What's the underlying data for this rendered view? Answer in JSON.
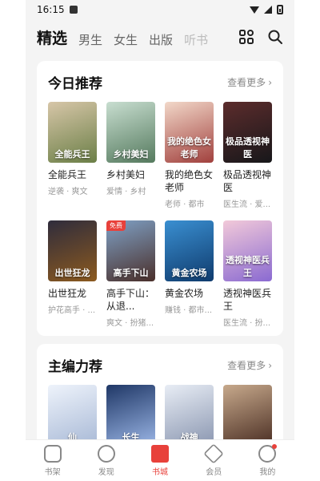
{
  "status": {
    "time": "16:15"
  },
  "topnav": {
    "tabs": [
      "精选",
      "男生",
      "女生",
      "出版",
      "听书"
    ],
    "active_index": 0
  },
  "colors": {
    "accent": "#e8413b",
    "background": "#f4f4f4"
  },
  "today": {
    "title": "今日推荐",
    "more_label": "查看更多",
    "books": [
      {
        "title": "全能兵王",
        "meta": "逆袭 · 爽文",
        "cover_text": "全能兵王",
        "cover_colors": [
          "#d7c6a8",
          "#6b7f47"
        ],
        "free": false
      },
      {
        "title": "乡村美妇",
        "meta": "爱情 · 乡村",
        "cover_text": "乡村美妇",
        "cover_colors": [
          "#c8ded0",
          "#557a5e"
        ],
        "free": false
      },
      {
        "title": "我的绝色女老师",
        "meta": "老师 · 都市",
        "cover_text": "我的绝色女老师",
        "cover_colors": [
          "#f2d8c9",
          "#a1403d"
        ],
        "free": false
      },
      {
        "title": "极品透视神医",
        "meta": "医生流 · 爱...",
        "cover_text": "极品透视神医",
        "cover_colors": [
          "#5c2c2c",
          "#17171a"
        ],
        "free": false
      },
      {
        "title": "出世狂龙",
        "meta": "护花高手 · ...",
        "cover_text": "出世狂龙",
        "cover_colors": [
          "#2f2c3c",
          "#8c5a1f"
        ],
        "free": false
      },
      {
        "title": "高手下山：从退...",
        "meta": "爽文 · 扮猪...",
        "cover_text": "高手下山",
        "cover_colors": [
          "#7fa1c6",
          "#4a2f2a"
        ],
        "free": true,
        "free_label": "免费"
      },
      {
        "title": "黄金农场",
        "meta": "赚钱 · 都市...",
        "cover_text": "黄金农场",
        "cover_colors": [
          "#3a8fd1",
          "#0f3b6d"
        ],
        "free": false
      },
      {
        "title": "透视神医兵王",
        "meta": "医生流 · 扮...",
        "cover_text": "透视神医兵王",
        "cover_colors": [
          "#f2c9d9",
          "#8a6ad1"
        ],
        "free": false
      }
    ]
  },
  "editor": {
    "title": "主编力荐",
    "more_label": "查看更多",
    "covers": [
      {
        "cover_colors": [
          "#eef3fb",
          "#a8b9d6"
        ],
        "cover_text": "仙"
      },
      {
        "cover_colors": [
          "#1f3766",
          "#9bb6e6"
        ],
        "cover_text": "长生"
      },
      {
        "cover_colors": [
          "#e8edf5",
          "#8a96b0"
        ],
        "cover_text": "战神"
      },
      {
        "cover_colors": [
          "#c7a98c",
          "#4a2e23"
        ],
        "cover_text": ""
      }
    ]
  },
  "bottomnav": {
    "items": [
      {
        "label": "书架",
        "icon": "bookshelf-icon"
      },
      {
        "label": "发现",
        "icon": "compass-icon"
      },
      {
        "label": "书城",
        "icon": "bookstore-icon"
      },
      {
        "label": "会员",
        "icon": "member-icon"
      },
      {
        "label": "我的",
        "icon": "profile-icon"
      }
    ],
    "active_index": 2
  }
}
